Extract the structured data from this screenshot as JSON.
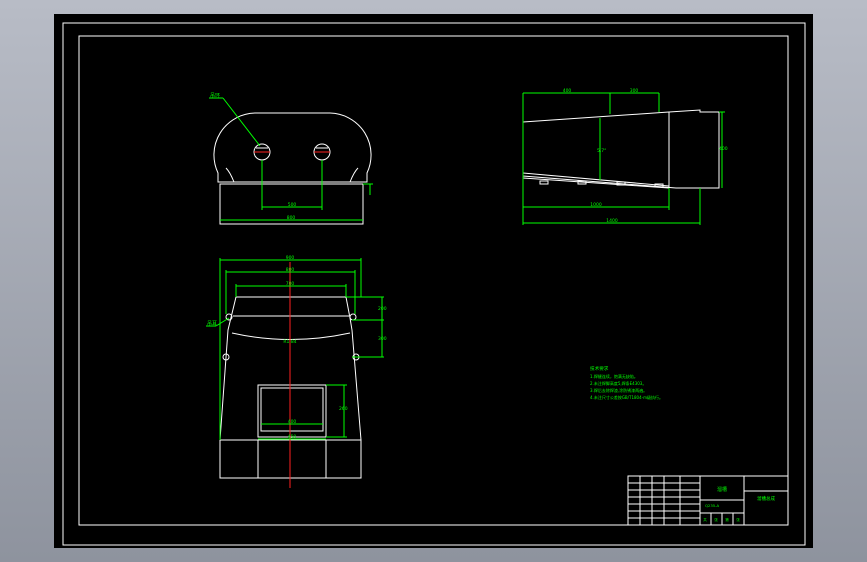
{
  "colors": {
    "viewport_bg": "#a7abb5",
    "sheet": "#000000",
    "border": "#ffffff",
    "outline": "#ffffff",
    "dimension": "#00ff00",
    "centerline": "#ff2020"
  },
  "top_view": {
    "leader_label": "吊环",
    "dim_hole_spacing": "500",
    "dim_base_width": "800"
  },
  "side_view": {
    "dim_top_left": "400",
    "dim_top_right": "300",
    "dim_angle": "5.7°",
    "dim_height": "400",
    "dim_lower": "1000",
    "dim_overall": "1400"
  },
  "front_view": {
    "leader_label": "吊耳",
    "dim_overall_width": "900",
    "dim_mid_width": "800",
    "dim_inner_width": "700",
    "dim_arc": "R1.84",
    "dim_right_upper": "200",
    "dim_right_lower": "300",
    "dim_window_height": "260",
    "dim_window_width": "400",
    "dim_bottom_width": "450"
  },
  "notes": {
    "title": "技术要求",
    "lines": [
      "1.焊缝连续，饱满无缺陷。",
      "2.未注焊脚高度5,焊条E4303。",
      "3.焊后去除焊渣,涂防锈漆两遍。",
      "4.未注尺寸公差按GB/T1804-m级执行。"
    ]
  },
  "title_block": {
    "name": "溜槽",
    "drawing_no": "溜槽总成",
    "material": "Q235-A",
    "scale_row": [
      "共",
      "张",
      "第",
      "张"
    ]
  }
}
